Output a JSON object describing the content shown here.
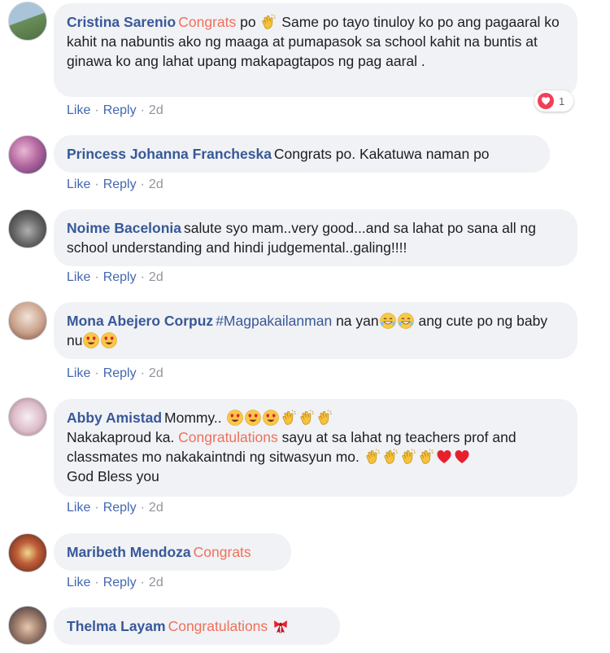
{
  "comments": [
    {
      "author": "Cristina Sarenio",
      "text_hl": "Congrats",
      "text_a": " po ",
      "text_b": " Same po tayo tinuloy ko po ang pagaaral ko kahit na nabuntis ako ng maaga at pumapasok sa school kahit na buntis at ginawa ko ang lahat upang makapagtapos ng pag aaral .",
      "like": "Like",
      "reply": "Reply",
      "time": "2d",
      "reaction_count": "1",
      "avatar_colors": [
        "#6b8e5a",
        "#a9c3d8"
      ]
    },
    {
      "author": "Princess Johanna Francheska",
      "text": "Congrats po. Kakatuwa naman po",
      "like": "Like",
      "reply": "Reply",
      "time": "2d",
      "avatar_colors": [
        "#7a4a8c",
        "#d8a0c8"
      ]
    },
    {
      "author": "Noime Bacelonia",
      "text": "salute syo mam..very good...and sa lahat po sana all ng school understanding and hindi judgemental..galing!!!!",
      "like": "Like",
      "reply": "Reply",
      "time": "2d",
      "avatar_colors": [
        "#4a4a4a",
        "#9a9a9a"
      ]
    },
    {
      "author": "Mona Abejero Corpuz",
      "tag": "#Magpakailanman",
      "text_a": " na yan",
      "text_b": " ang cute po ng baby nu",
      "like": "Like",
      "reply": "Reply",
      "time": "2d",
      "avatar_colors": [
        "#c9a08a",
        "#e8d3c4"
      ]
    },
    {
      "author": "Abby Amistad",
      "text_a": "Mommy.. ",
      "line2_a": "Nakakaproud ka. ",
      "text_hl": "Congratulations",
      "line2_b": " sayu at sa lahat ng teachers prof and classmates mo nakakaintndi ng sitwasyun mo. ",
      "line3": "God Bless you",
      "like": "Like",
      "reply": "Reply",
      "time": "2d",
      "avatar_colors": [
        "#d9b6c4",
        "#f2e2e8"
      ]
    },
    {
      "author": "Maribeth Mendoza",
      "text_hl": "Congrats",
      "like": "Like",
      "reply": "Reply",
      "time": "2d",
      "avatar_colors": [
        "#8a3b2a",
        "#d8b070"
      ]
    },
    {
      "author": "Thelma Layam",
      "text_hl": "Congratulations",
      "avatar_colors": [
        "#2d2d3a",
        "#c8a890"
      ]
    }
  ]
}
